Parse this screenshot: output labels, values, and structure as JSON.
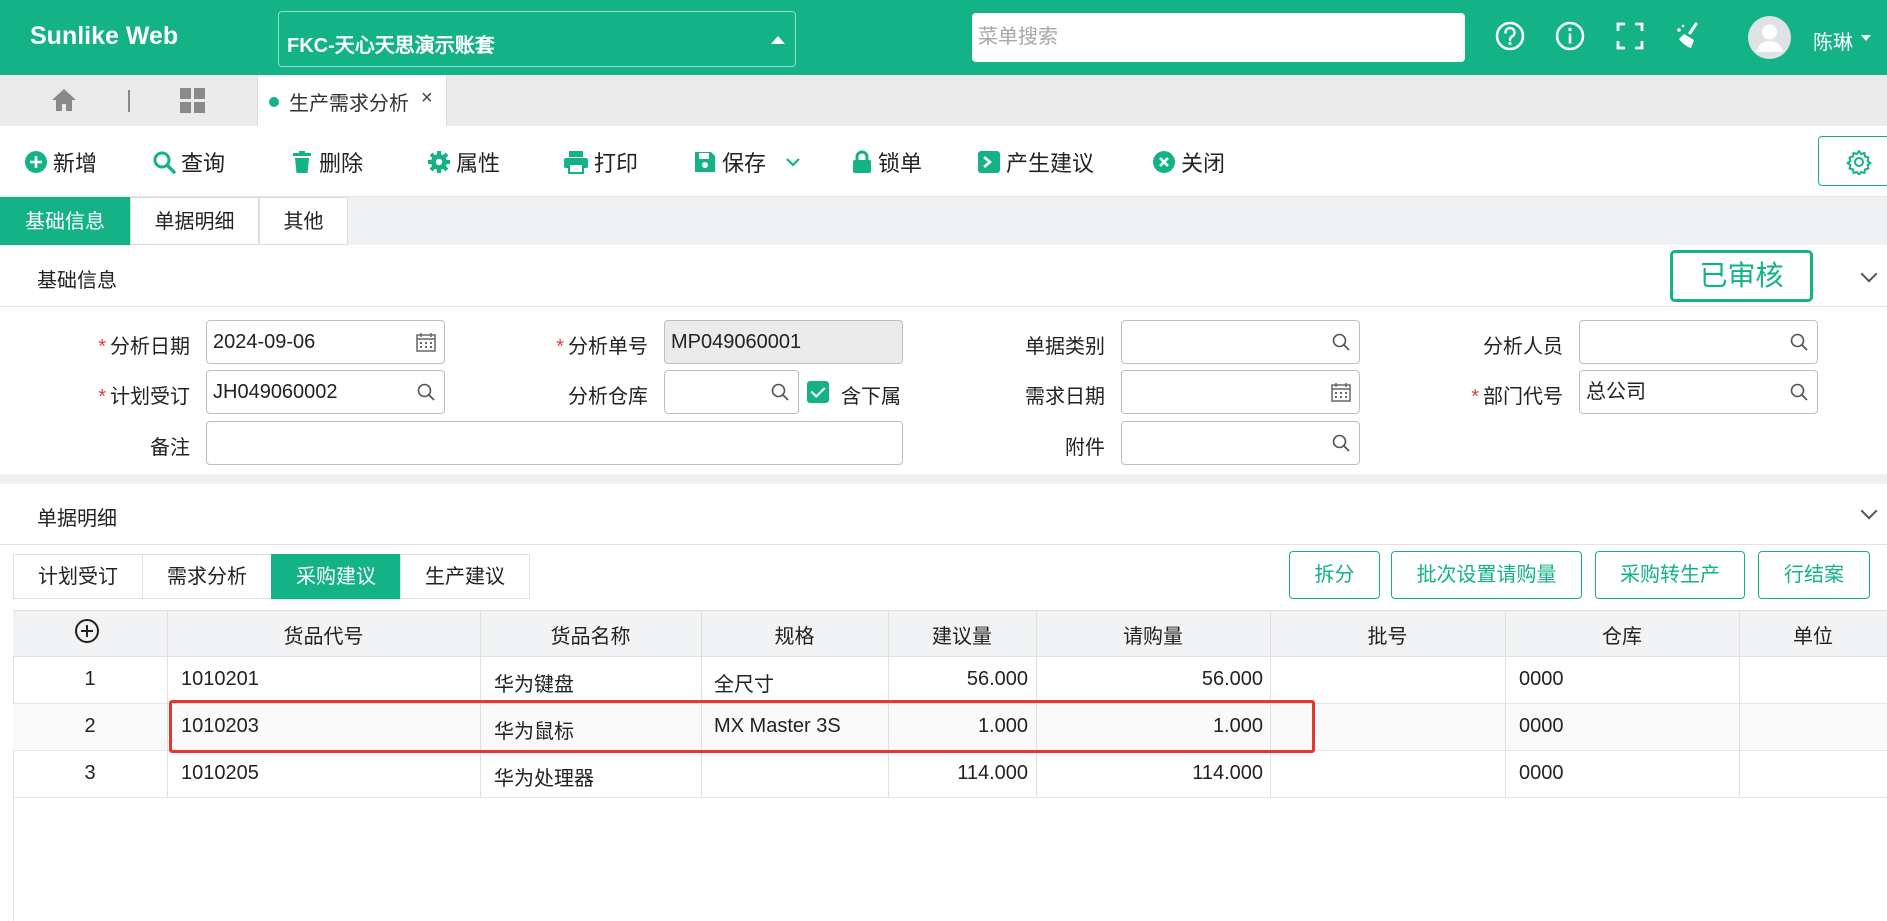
{
  "app": {
    "brand": "Sunlike Web",
    "account": "FKC-天心天思演示账套",
    "search_placeholder": "菜单搜索",
    "user_name": "陈琳",
    "accent_color": "#13b287"
  },
  "tabs": {
    "page_tab_label": "生产需求分析",
    "close_glyph": "×"
  },
  "toolbar": {
    "new": "新增",
    "query": "查询",
    "delete": "删除",
    "properties": "属性",
    "print": "打印",
    "save": "保存",
    "lock": "锁单",
    "generate": "产生建议",
    "close": "关闭"
  },
  "section_tabs": [
    "基础信息",
    "单据明细",
    "其他"
  ],
  "basic": {
    "title": "基础信息",
    "status": "已审核",
    "fields": {
      "analysis_date_label": "分析日期",
      "analysis_date": "2024-09-06",
      "analysis_no_label": "分析单号",
      "analysis_no": "MP049060001",
      "doc_type_label": "单据类别",
      "doc_type": "",
      "analyst_label": "分析人员",
      "analyst": "",
      "plan_order_label": "计划受订",
      "plan_order": "JH049060002",
      "warehouse_label": "分析仓库",
      "warehouse": "",
      "include_sub_label": "含下属",
      "include_sub": true,
      "demand_date_label": "需求日期",
      "demand_date": "",
      "dept_label": "部门代号",
      "dept": "总公司",
      "remark_label": "备注",
      "remark": "",
      "attachment_label": "附件",
      "attachment": ""
    }
  },
  "detail": {
    "title": "单据明细",
    "tabs": [
      "计划受订",
      "需求分析",
      "采购建议",
      "生产建议"
    ],
    "active_tab": "采购建议",
    "actions": [
      "拆分",
      "批次设置请购量",
      "采购转生产",
      "行结案"
    ],
    "columns": [
      "货品代号",
      "货品名称",
      "规格",
      "建议量",
      "请购量",
      "批号",
      "仓库",
      "单位"
    ],
    "rows": [
      {
        "no": "1",
        "code": "1010201",
        "name": "华为键盘",
        "spec": "全尺寸",
        "suggest": "56.000",
        "request": "56.000",
        "batch": "",
        "warehouse": "0000",
        "unit": ""
      },
      {
        "no": "2",
        "code": "1010203",
        "name": "华为鼠标",
        "spec": "MX Master 3S",
        "suggest": "1.000",
        "request": "1.000",
        "batch": "",
        "warehouse": "0000",
        "unit": ""
      },
      {
        "no": "3",
        "code": "1010205",
        "name": "华为处理器",
        "spec": "",
        "suggest": "114.000",
        "request": "114.000",
        "batch": "",
        "warehouse": "0000",
        "unit": ""
      }
    ]
  }
}
